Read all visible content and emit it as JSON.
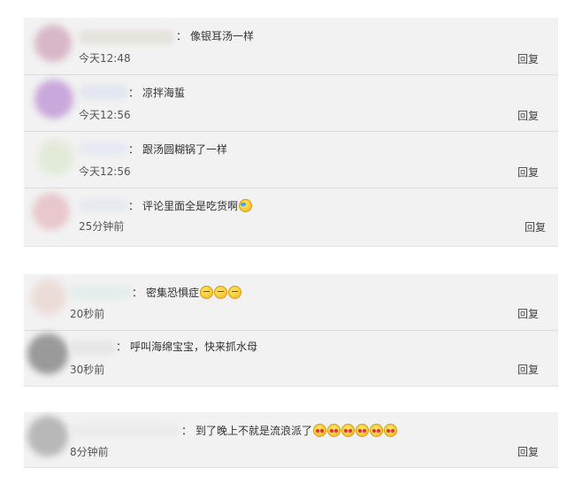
{
  "reply_label": "回复",
  "colon": "：",
  "groups": [
    {
      "comments": [
        {
          "text": "像银耳汤一样",
          "time": "今天12:48",
          "avatar_color": "#d8b8c8",
          "name_color": "#e6e2dc",
          "emojis": []
        },
        {
          "text": "凉拌海蜇",
          "time": "今天12:56",
          "avatar_color": "#c9a8dc",
          "name_color": "#e2e6f0",
          "emojis": []
        },
        {
          "text": "跟汤圆糊锅了一样",
          "time": "今天12:56",
          "avatar_color": "#e2ead8",
          "name_color": "#e6eaf2",
          "emojis": []
        },
        {
          "text": "评论里面全是吃货啊",
          "time": "25分钟前",
          "avatar_color": "#e8c8cc",
          "name_color": "#e6eaf0",
          "emojis": [
            "laughing-crying-icon"
          ]
        }
      ]
    },
    {
      "comments": [
        {
          "text": "密集恐惧症",
          "time": "20秒前",
          "avatar_color": "#ecdcd8",
          "name_color": "#e4ecec",
          "emojis": [
            "sleepy-face-icon",
            "sleepy-face-icon",
            "sleepy-face-icon"
          ]
        },
        {
          "text": "呼叫海绵宝宝，快来抓水母",
          "time": "30秒前",
          "avatar_color": "#9a9a9a",
          "name_color": "#e6e6e6",
          "emojis": []
        }
      ]
    },
    {
      "comments": [
        {
          "text": "到了晚上不就是流浪派了",
          "time": "8分钟前",
          "avatar_color": "#b8b8b8",
          "name_color": "#ececec",
          "emojis": [
            "kissing-face-icon",
            "kissing-face-icon",
            "kissing-face-icon",
            "heart-eyes-icon",
            "heart-eyes-icon",
            "heart-eyes-icon"
          ]
        }
      ]
    }
  ]
}
